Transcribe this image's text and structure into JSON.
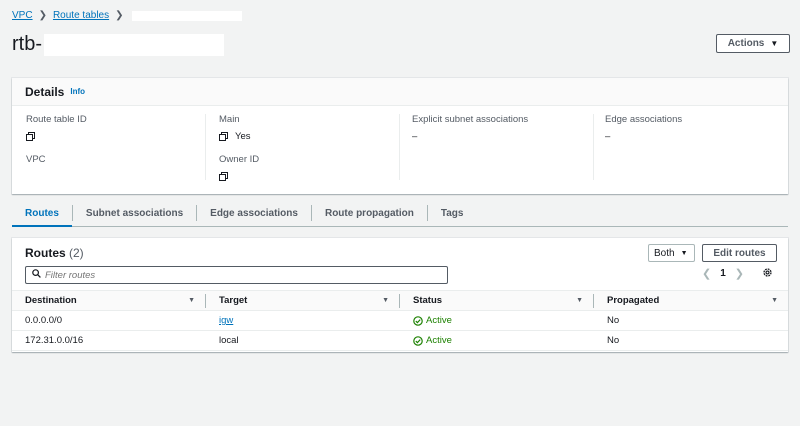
{
  "breadcrumb": {
    "items": [
      "VPC",
      "Route tables"
    ]
  },
  "page": {
    "title": "rtb-"
  },
  "actions": {
    "label": "Actions"
  },
  "details": {
    "title": "Details",
    "info": "Info",
    "route_table_id_label": "Route table ID",
    "main_label": "Main",
    "main_value": "Yes",
    "explicit_label": "Explicit subnet associations",
    "explicit_value": "–",
    "edge_label": "Edge associations",
    "edge_value": "–",
    "vpc_label": "VPC",
    "owner_label": "Owner ID"
  },
  "tabs": [
    "Routes",
    "Subnet associations",
    "Edge associations",
    "Route propagation",
    "Tags"
  ],
  "routes": {
    "title": "Routes",
    "count": "(2)",
    "both_label": "Both",
    "edit_label": "Edit routes",
    "filter_placeholder": "Filter routes",
    "page": "1",
    "columns": [
      "Destination",
      "Target",
      "Status",
      "Propagated"
    ],
    "rows": [
      {
        "destination": "0.0.0.0/0",
        "target": "igw",
        "status": "Active",
        "propagated": "No"
      },
      {
        "destination": "172.31.0.0/16",
        "target": "local",
        "status": "Active",
        "propagated": "No"
      }
    ]
  },
  "colors": {
    "link": "#0073bb",
    "success": "#1d8102",
    "text": "#16191f",
    "muted": "#545b64"
  }
}
